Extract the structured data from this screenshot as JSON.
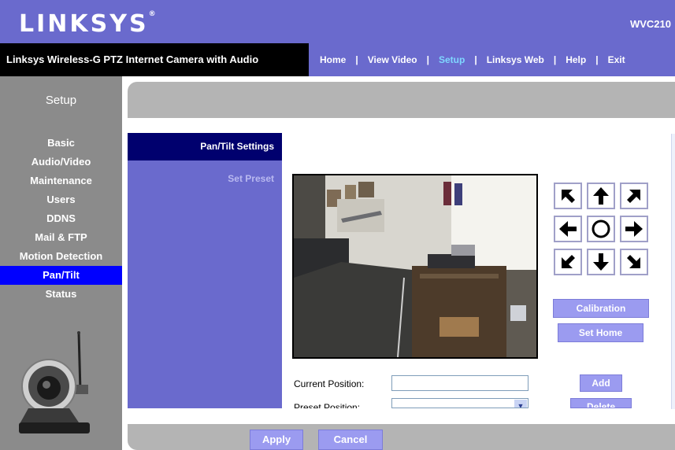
{
  "header": {
    "logo": "LINKSYS",
    "logo_mark": "®",
    "model": "WVC210"
  },
  "navbar": {
    "product": "Linksys Wireless-G PTZ Internet Camera with Audio",
    "links": [
      {
        "label": "Home"
      },
      {
        "label": "View Video"
      },
      {
        "label": "Setup",
        "active": true
      },
      {
        "label": "Linksys Web"
      },
      {
        "label": "Help"
      },
      {
        "label": "Exit"
      }
    ],
    "active_color": "#7fd7ff"
  },
  "left_menu": {
    "title": "Setup",
    "items": [
      {
        "label": "Basic"
      },
      {
        "label": "Audio/Video"
      },
      {
        "label": "Maintenance"
      },
      {
        "label": "Users"
      },
      {
        "label": "DDNS"
      },
      {
        "label": "Mail & FTP"
      },
      {
        "label": "Motion Detection"
      },
      {
        "label": "Pan/Tilt",
        "active": true
      },
      {
        "label": "Status"
      }
    ]
  },
  "sub_menu": {
    "active": "Pan/Tilt Settings",
    "items": [
      {
        "label": "Set Preset"
      }
    ]
  },
  "controls": {
    "calibration_label": "Calibration",
    "set_home_label": "Set Home",
    "add_label": "Add",
    "delete_label": "Delete"
  },
  "form": {
    "current_position_label": "Current Position:",
    "current_position_value": "",
    "preset_position_label": "Preset Position:",
    "preset_position_value": ""
  },
  "footer": {
    "apply_label": "Apply",
    "cancel_label": "Cancel"
  },
  "colors": {
    "brand_purple": "#6a6acd",
    "nav_black": "#000000",
    "menu_gray": "#8b8b8b",
    "active_blue": "#0000ff",
    "sub_active_navy": "#00006e",
    "button_purple": "#9b9bf0"
  }
}
